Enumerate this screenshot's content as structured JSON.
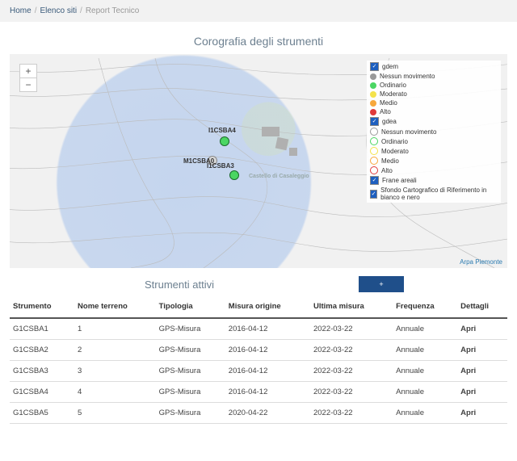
{
  "breadcrumb": {
    "home": "Home",
    "list": "Elenco siti",
    "current": "Report Tecnico"
  },
  "titles": {
    "map_section": "Corografia degli strumenti",
    "table_section": "Strumenti attivi"
  },
  "zoom": {
    "in": "+",
    "out": "−"
  },
  "map_labels": {
    "p1": "I1CSBA4",
    "p2": "M1CSBA0",
    "p3": "I1CSBA3",
    "pl": "Castello di Casaleggio"
  },
  "legend": {
    "grp1": "gdem",
    "grp2": "gdea",
    "none": "Nessun movimento",
    "ordinario": "Ordinario",
    "moderato": "Moderato",
    "medio": "Medio",
    "alto": "Alto",
    "frane": "Frane areali",
    "sfondo": "Sfondo Cartografico di Riferimento in bianco e nero"
  },
  "attribution": "Arpa Piemonte",
  "export_btn": "+",
  "table": {
    "headers": {
      "instrument": "Strumento",
      "terrain": "Nome terreno",
      "type": "Tipologia",
      "origin": "Misura origine",
      "last": "Ultima misura",
      "freq": "Frequenza",
      "details": "Dettagli"
    },
    "open_label": "Apri",
    "rows": [
      {
        "instrument": "G1CSBA1",
        "terrain": "1",
        "type": "GPS-Misura",
        "origin": "2016-04-12",
        "last": "2022-03-22",
        "freq": "Annuale"
      },
      {
        "instrument": "G1CSBA2",
        "terrain": "2",
        "type": "GPS-Misura",
        "origin": "2016-04-12",
        "last": "2022-03-22",
        "freq": "Annuale"
      },
      {
        "instrument": "G1CSBA3",
        "terrain": "3",
        "type": "GPS-Misura",
        "origin": "2016-04-12",
        "last": "2022-03-22",
        "freq": "Annuale"
      },
      {
        "instrument": "G1CSBA4",
        "terrain": "4",
        "type": "GPS-Misura",
        "origin": "2016-04-12",
        "last": "2022-03-22",
        "freq": "Annuale"
      },
      {
        "instrument": "G1CSBA5",
        "terrain": "5",
        "type": "GPS-Misura",
        "origin": "2020-04-22",
        "last": "2022-03-22",
        "freq": "Annuale"
      }
    ]
  }
}
